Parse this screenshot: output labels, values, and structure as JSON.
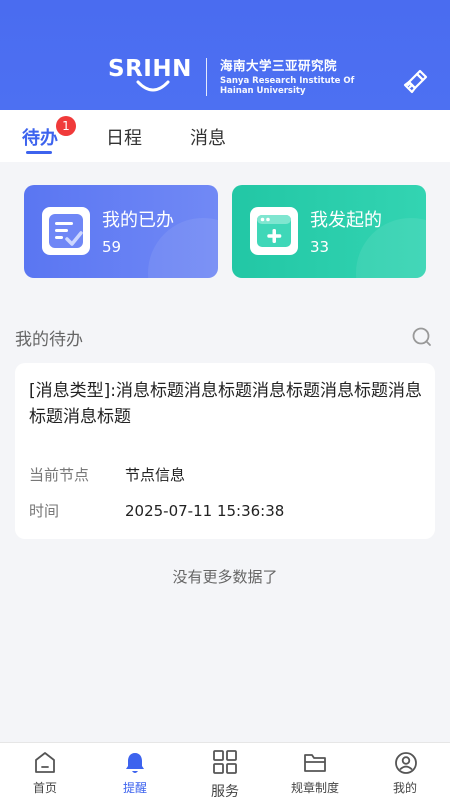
{
  "header": {
    "logo_letters": "SRIHN",
    "org_name_cn": "海南大学三亚研究院",
    "org_name_en_line1": "Sanya Research Institute Of",
    "org_name_en_line2": "Hainan University",
    "clear_icon": "brush-icon"
  },
  "tabs": [
    {
      "label": "待办",
      "active": true,
      "badge": "1"
    },
    {
      "label": "日程",
      "active": false
    },
    {
      "label": "消息",
      "active": false
    }
  ],
  "stats": [
    {
      "title": "我的已办",
      "count": "59",
      "icon": "checklist-icon",
      "color": "#5a76f2"
    },
    {
      "title": "我发起的",
      "count": "33",
      "icon": "add-window-icon",
      "color": "#22c7a5"
    }
  ],
  "section": {
    "title": "我的待办",
    "search_icon": "search-icon"
  },
  "todo": {
    "title": "[消息类型]:消息标题消息标题消息标题消息标题消息标题消息标题",
    "node_label": "当前节点",
    "node_value": "节点信息",
    "time_label": "时间",
    "time_value": "2025-07-11 15:36:38"
  },
  "no_more": "没有更多数据了",
  "bottom_nav": [
    {
      "label": "首页",
      "icon": "home-icon",
      "active": false
    },
    {
      "label": "提醒",
      "icon": "bell-icon",
      "active": true
    },
    {
      "label": "服务",
      "icon": "grid-icon",
      "active": false
    },
    {
      "label": "规章制度",
      "icon": "folder-icon",
      "active": false
    },
    {
      "label": "我的",
      "icon": "user-icon",
      "active": false
    }
  ],
  "colors": {
    "accent": "#3d63ee",
    "header_bg": "#4a6cf0",
    "badge": "#f03a3a",
    "green_card": "#22c7a5"
  }
}
